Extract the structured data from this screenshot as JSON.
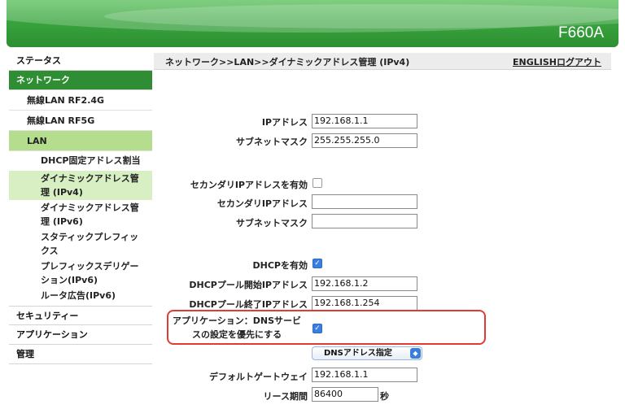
{
  "header": {
    "model": "F660A"
  },
  "topbar": {
    "breadcrumb": "ネットワーク>>LAN>>ダイナミックアドレス管理 (IPv4)",
    "english_link": "ENGLISH",
    "logout_link": "ログアウト"
  },
  "sidebar": {
    "status": "ステータス",
    "network": "ネットワーク",
    "wlan24": "無線LAN RF2.4G",
    "wlan5": "無線LAN RF5G",
    "lan": "LAN",
    "lan_items": [
      "DHCP固定アドレス割当",
      "ダイナミックアドレス管理 (IPv4)",
      "ダイナミックアドレス管理 (IPv6)",
      "スタティックプレフィックス",
      "プレフィックスデリゲーション(IPv6)",
      "ルータ広告(IPv6)"
    ],
    "security": "セキュリティー",
    "application": "アプリケーション",
    "admin": "管理"
  },
  "form": {
    "ip_label": "IPアドレス",
    "ip_value": "192.168.1.1",
    "subnet_label": "サブネットマスク",
    "subnet_value": "255.255.255.0",
    "secondary_enable_label": "セカンダリIPアドレスを有効",
    "secondary_enable_checked": false,
    "secondary_ip_label": "セカンダリIPアドレス",
    "secondary_ip_value": "",
    "secondary_subnet_label": "サブネットマスク",
    "secondary_subnet_value": "",
    "dhcp_enable_label": "DHCPを有効",
    "dhcp_enable_checked": true,
    "pool_start_label": "DHCPプール開始IPアドレス",
    "pool_start_value": "192.168.1.2",
    "pool_end_label": "DHCPプール終了IPアドレス",
    "pool_end_value": "192.168.1.254",
    "app_dns_label_line1": "アプリケーション：DNSサービ",
    "app_dns_label_line2": "スの設定を優先にする",
    "app_dns_checked": true,
    "dns_select_value": "DNSアドレス指定",
    "gateway_label": "デフォルトゲートウェイ",
    "gateway_value": "192.168.1.1",
    "lease_label": "リース期間",
    "lease_value": "86400",
    "lease_unit": "秒"
  },
  "colors": {
    "brand_green": "#2f8d34",
    "highlight_red": "#e23b35",
    "checkbox_blue": "#3a7fe0"
  }
}
